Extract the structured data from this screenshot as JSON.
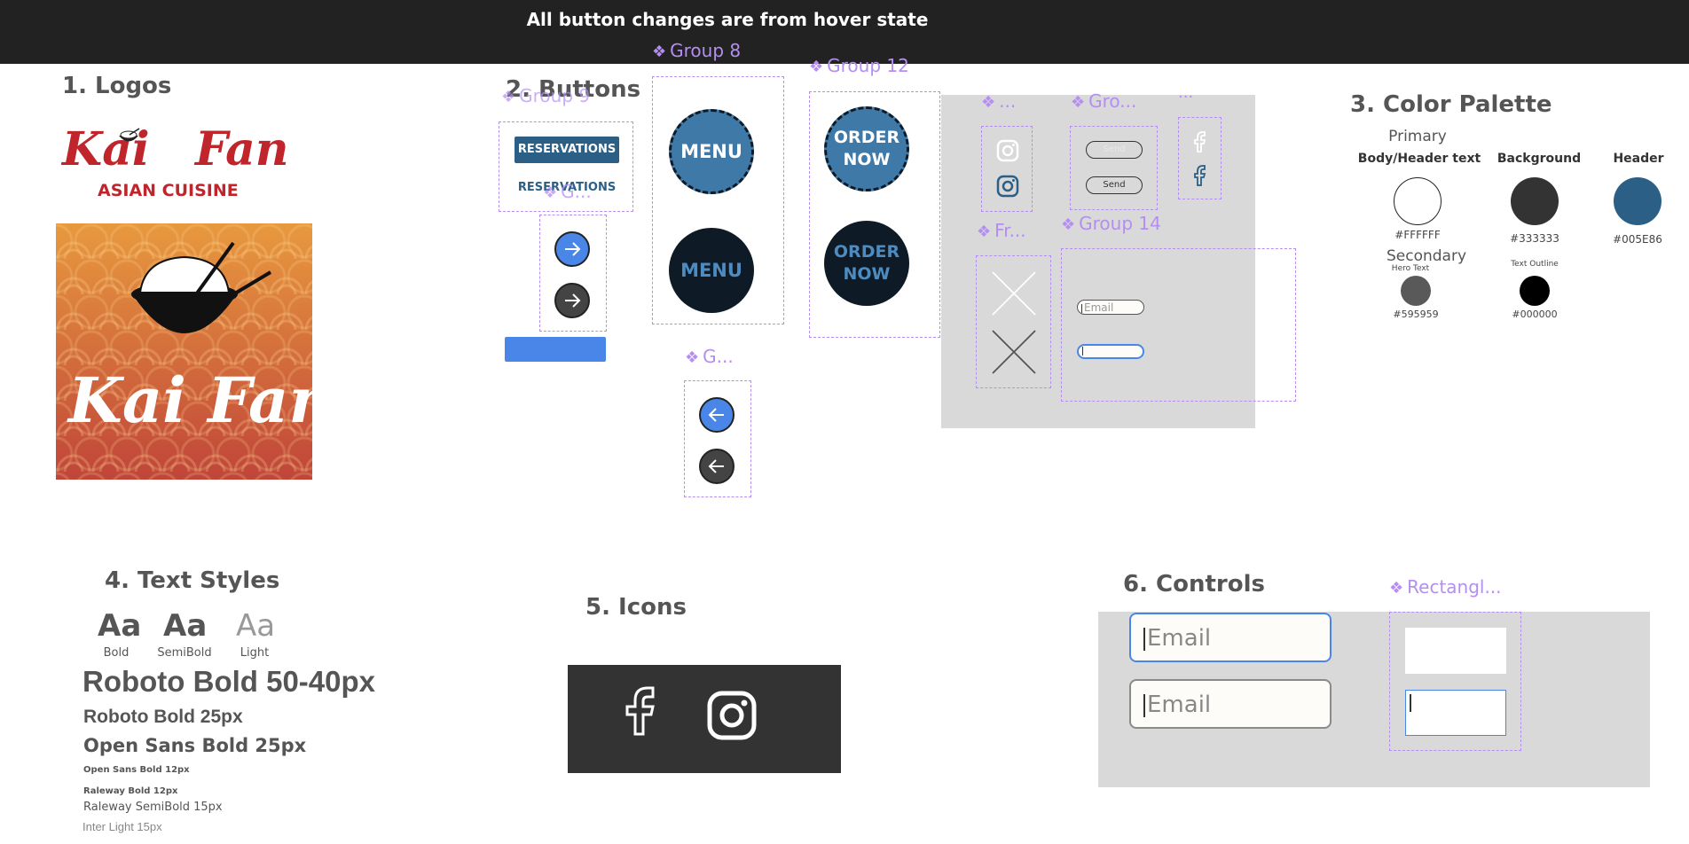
{
  "header": {
    "title": "All button changes are from hover state"
  },
  "sections": {
    "logos": "1. Logos",
    "buttons": "2. Buttons",
    "palette": "3. Color Palette",
    "text_styles": "4. Text Styles",
    "icons": "5. Icons",
    "controls": "6. Controls"
  },
  "logos": {
    "wordmark_left": "Kai",
    "wordmark_right": "Fan",
    "tagline": "ASIAN CUISINE",
    "square_text": "Kai Fan",
    "colors": {
      "red": "#c0252b",
      "orange": "#e38a3a",
      "deep": "#c0453a"
    }
  },
  "groups": {
    "g8": "Group 8",
    "g12": "Group 12",
    "g14": "Group 14",
    "group_overlap": "Group 9",
    "small": "G...",
    "ellipsis": "...",
    "gro": "Gro...",
    "fr": "Fr...",
    "arrow_group": "G...",
    "rect": "Rectangl..."
  },
  "buttons": {
    "reservations": "RESERVATIONS",
    "reservations_hover": "RESERVATIONS",
    "menu": "MENU",
    "menu_hover": "MENU",
    "order_line1": "ORDER",
    "order_line2": "NOW",
    "send": "Send",
    "send_hover": "Send",
    "email_placeholder": "Email",
    "colors": {
      "blue": "#2b5f86",
      "bright_blue": "#4a86e8",
      "dark": "#0e1a26",
      "gray_btn": "#444444"
    }
  },
  "palette": {
    "primary": "Primary",
    "secondary": "Secondary",
    "items": [
      {
        "label": "Body/Header text",
        "hex": "#FFFFFF",
        "color": "#FFFFFF"
      },
      {
        "label": "Background",
        "hex": "#333333",
        "color": "#333333"
      },
      {
        "label": "Header",
        "hex": "#005E86",
        "color": "#2b5f86"
      }
    ],
    "secondary_items": [
      {
        "label": "Hero Text",
        "hex": "#595959",
        "color": "#595959"
      },
      {
        "label": "Text Outline",
        "hex": "#000000",
        "color": "#000000"
      }
    ]
  },
  "text_styles": {
    "weights": [
      {
        "sample": "Aa",
        "caption": "Bold"
      },
      {
        "sample": "Aa",
        "caption": "SemiBold"
      },
      {
        "sample": "Aa",
        "caption": "Light"
      }
    ],
    "lines": [
      "Roboto Bold 50-40px",
      "Roboto Bold 25px",
      "Open Sans Bold 25px",
      "Open Sans Bold 12px",
      "Raleway Bold 12px",
      "Raleway SemiBold 15px",
      "Inter Light 15px"
    ]
  },
  "icons": {
    "facebook": "facebook-icon",
    "instagram": "instagram-icon",
    "panel_color": "#333333"
  },
  "controls": {
    "email_placeholder": "Email",
    "focus_color": "#4a86e8"
  }
}
